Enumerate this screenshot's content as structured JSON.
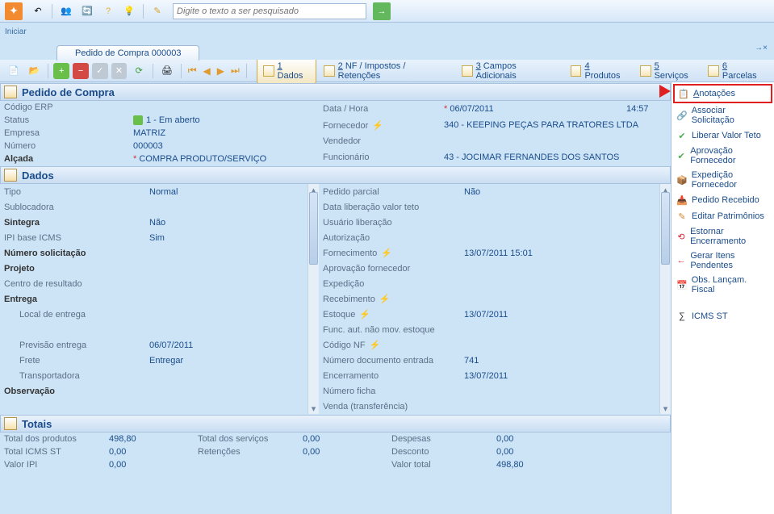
{
  "app": {
    "start_label": "Iniciar",
    "search_placeholder": "Digite o texto a ser pesquisado",
    "tab_title": "Pedido de Compra 000003",
    "close_symbol": "→×"
  },
  "section_tabs": [
    {
      "num": "1",
      "label": "Dados",
      "active": true
    },
    {
      "num": "2",
      "label": "NF / Impostos / Retenções",
      "active": false
    },
    {
      "num": "3",
      "label": "Campos Adicionais",
      "active": false
    },
    {
      "num": "4",
      "label": "Produtos",
      "active": false
    },
    {
      "num": "5",
      "label": "Serviços",
      "active": false
    },
    {
      "num": "6",
      "label": "Parcelas",
      "active": false
    }
  ],
  "header_panel": {
    "title": "Pedido de Compra",
    "left": [
      {
        "label": "Código ERP",
        "value": "",
        "bold": false
      },
      {
        "label": "Status",
        "value": "1 - Em aberto",
        "chip": true,
        "bold": false
      },
      {
        "label": "Empresa",
        "value": "MATRIZ",
        "bold": false
      },
      {
        "label": "Número",
        "value": "000003",
        "bold": false
      },
      {
        "label": "Alçada",
        "value": "COMPRA PRODUTO/SERVIÇO",
        "required": true,
        "bold": true
      }
    ],
    "right": [
      {
        "label": "Data / Hora",
        "value": "06/07/2011",
        "extra": "14:57",
        "required": true
      },
      {
        "label": "Fornecedor",
        "value": "340 - KEEPING PEÇAS PARA TRATORES LTDA",
        "bolt": true
      },
      {
        "label": "Vendedor",
        "value": ""
      },
      {
        "label": "Funcionário",
        "value": "43 - JOCIMAR FERNANDES DOS SANTOS"
      }
    ]
  },
  "dados_panel": {
    "title": "Dados",
    "left": [
      {
        "label": "Tipo",
        "value": "Normal",
        "bold": false
      },
      {
        "label": "Sublocadora",
        "value": "",
        "bold": false
      },
      {
        "label": "Sintegra",
        "value": "Não",
        "bold": true
      },
      {
        "label": "IPI base ICMS",
        "value": "Sim",
        "bold": false
      },
      {
        "label": "Número solicitação",
        "value": "",
        "bold": true
      },
      {
        "label": "Projeto",
        "value": "",
        "bold": true
      },
      {
        "label": "Centro de resultado",
        "value": "",
        "bold": false
      },
      {
        "label": "Entrega",
        "value": "",
        "bold": true,
        "header": true
      },
      {
        "label": "Local de entrega",
        "value": "",
        "indent": true
      },
      {
        "label": "",
        "value": ""
      },
      {
        "label": "Previsão entrega",
        "value": "06/07/2011",
        "indent": true
      },
      {
        "label": "Frete",
        "value": "Entregar",
        "indent": true
      },
      {
        "label": "Transportadora",
        "value": "",
        "indent": true
      },
      {
        "label": "Observação",
        "value": "",
        "bold": true
      }
    ],
    "right": [
      {
        "label": "Pedido parcial",
        "value": "Não"
      },
      {
        "label": "Data liberação valor teto",
        "value": ""
      },
      {
        "label": "Usuário liberação",
        "value": ""
      },
      {
        "label": "Autorização",
        "value": ""
      },
      {
        "label": "Fornecimento",
        "value": "13/07/2011 15:01",
        "bolt": true
      },
      {
        "label": "Aprovação fornecedor",
        "value": ""
      },
      {
        "label": "Expedição",
        "value": ""
      },
      {
        "label": "Recebimento",
        "value": "",
        "bolt": true
      },
      {
        "label": "Estoque",
        "value": "13/07/2011",
        "bolt": true
      },
      {
        "label": "Func. aut. não mov. estoque",
        "value": ""
      },
      {
        "label": "Código NF",
        "value": "",
        "bolt": true
      },
      {
        "label": "Número documento entrada",
        "value": "741"
      },
      {
        "label": "Encerramento",
        "value": "13/07/2011"
      },
      {
        "label": "Número ficha",
        "value": ""
      },
      {
        "label": "Venda (transferência)",
        "value": ""
      }
    ]
  },
  "totals_panel": {
    "title": "Totais",
    "rows": [
      [
        {
          "l": "Total dos produtos",
          "v": "498,80"
        },
        {
          "l": "Total dos serviços",
          "v": "0,00"
        },
        {
          "l": "Despesas",
          "v": "0,00"
        }
      ],
      [
        {
          "l": "Total ICMS ST",
          "v": "0,00"
        },
        {
          "l": "Retenções",
          "v": "0,00"
        },
        {
          "l": "Desconto",
          "v": "0,00"
        }
      ],
      [
        {
          "l": "Valor IPI",
          "v": "0,00"
        },
        {
          "l": "",
          "v": ""
        },
        {
          "l": "Valor total",
          "v": "498,80"
        }
      ]
    ]
  },
  "side_menu": [
    {
      "label": "Anotações",
      "icon": "📋",
      "highlight": true,
      "underline": "A"
    },
    {
      "label": "Associar Solicitação",
      "icon": "🔗",
      "color": "#e0a030"
    },
    {
      "label": "Liberar Valor Teto",
      "icon": "✔",
      "color": "#4caf50"
    },
    {
      "label": "Aprovação Fornecedor",
      "icon": "✔",
      "color": "#4caf50"
    },
    {
      "label": "Expedição Fornecedor",
      "icon": "📦",
      "color": "#c98b2e"
    },
    {
      "label": "Pedido Recebido",
      "icon": "📥",
      "color": "#c98b2e"
    },
    {
      "label": "Editar Patrimônios",
      "icon": "✎",
      "color": "#d1852e"
    },
    {
      "label": "Estornar Encerramento",
      "icon": "⟲",
      "color": "#d23"
    },
    {
      "label": "Gerar Itens Pendentes",
      "icon": "←",
      "color": "#d23"
    },
    {
      "label": "Obs. Lançam. Fiscal",
      "icon": "📅",
      "color": "#d23"
    },
    {
      "label": "",
      "icon": "",
      "spacer": true
    },
    {
      "label": "ICMS ST",
      "icon": "∑",
      "color": "#333"
    }
  ]
}
